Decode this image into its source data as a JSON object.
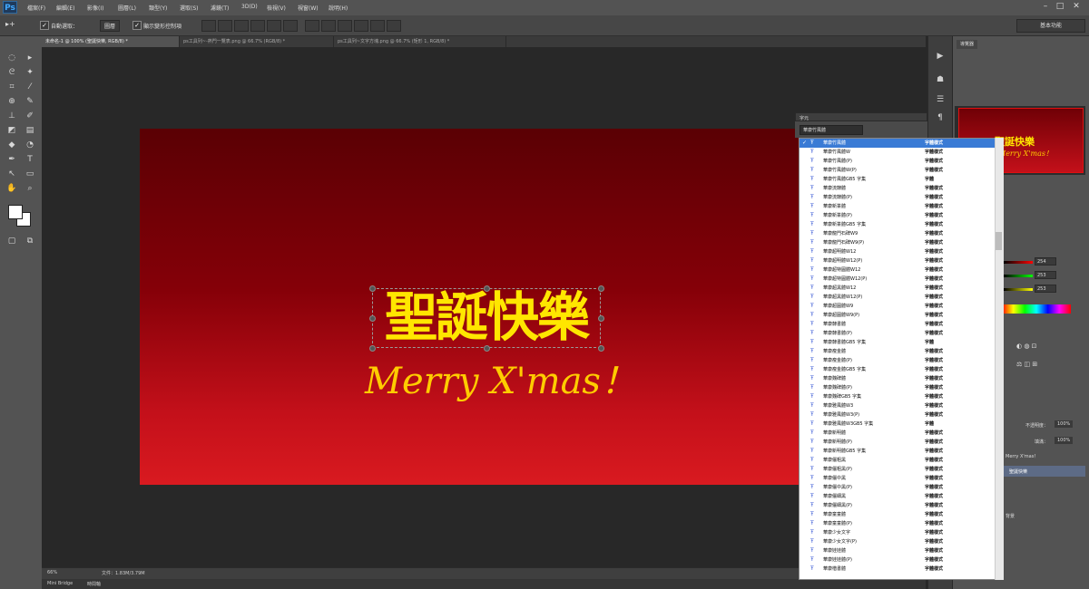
{
  "app": {
    "logo": "Ps"
  },
  "menu": [
    "檔案(F)",
    "編輯(E)",
    "影像(I)",
    "圖層(L)",
    "類型(Y)",
    "選取(S)",
    "濾鏡(T)",
    "3D(D)",
    "檢視(V)",
    "視窗(W)",
    "說明(H)"
  ],
  "window_controls": {
    "min": "–",
    "max": "□",
    "close": "✕"
  },
  "options_bar": {
    "auto_select_label": "自動選取：",
    "auto_select_value": "圖層",
    "show_transform_label": "顯示變形控制項",
    "workspace": "基本功能"
  },
  "tabs": [
    "未命名-1 @ 100% (聖誕快樂, RGB/8) *",
    "ps工具列~-熱門一覽表.png @ 66.7% (RGB/8) *",
    "ps工具列~文字方塊.png @ 66.7% (矩形 1, RGB/8) *"
  ],
  "document": {
    "title_cn": "聖誕快樂",
    "title_en": "Merry X'mas！",
    "gradient_colors": [
      "#5a0004",
      "#850008",
      "#c4101a",
      "#d91a20"
    ],
    "text_color": "#ffe600"
  },
  "status": {
    "zoom": "66%",
    "doc_info": "文件：1.83M/3.79M",
    "bridge_tab": "Mini Bridge",
    "timeline_tab": "時間軸"
  },
  "right_panel": {
    "navigator_tab": "導覽器",
    "nav_title_cn": "聖誕快樂",
    "nav_title_en": "Merry X'mas！",
    "color_values": [
      "254",
      "253",
      "253"
    ],
    "opacity_label": "不透明度：",
    "opacity_value": "100%",
    "fill_label": "填滿：",
    "fill_value": "100%",
    "layer_text": "Merry X'mas！",
    "layer_selected": "聖誕快樂",
    "layer_bg": "背景"
  },
  "font_panel": {
    "title": "字元",
    "current_font": "華康竹風體",
    "fonts": [
      {
        "name": "華康竹風體",
        "sample": "字體樣式",
        "selected": true
      },
      {
        "name": "華康竹風體W",
        "sample": "字體樣式"
      },
      {
        "name": "華康竹風體(P)",
        "sample": "字體樣式"
      },
      {
        "name": "華康竹風體W(P)",
        "sample": "字體樣式"
      },
      {
        "name": "華康竹風體GB5 字集",
        "sample": "字體"
      },
      {
        "name": "華康流隸體",
        "sample": "字體樣式"
      },
      {
        "name": "華康流隸體(P)",
        "sample": "字體樣式"
      },
      {
        "name": "華康新篆體",
        "sample": "字體樣式"
      },
      {
        "name": "華康新篆體(P)",
        "sample": "字體樣式"
      },
      {
        "name": "華康新篆體GB5 字集",
        "sample": "字體樣式"
      },
      {
        "name": "華康龍門石碑W9",
        "sample": "字體樣式"
      },
      {
        "name": "華康龍門石碑W9(P)",
        "sample": "字體樣式"
      },
      {
        "name": "華康超明體W12",
        "sample": "字體樣式"
      },
      {
        "name": "華康超明體W12(P)",
        "sample": "字體樣式"
      },
      {
        "name": "華康超特圓體W12",
        "sample": "字體樣式"
      },
      {
        "name": "華康超特圓體W12(P)",
        "sample": "字體樣式"
      },
      {
        "name": "華康超黑體W12",
        "sample": "字體樣式"
      },
      {
        "name": "華康超黑體W12(P)",
        "sample": "字體樣式"
      },
      {
        "name": "華康超圓體W9",
        "sample": "字體樣式"
      },
      {
        "name": "華康超圓體W9(P)",
        "sample": "字體樣式"
      },
      {
        "name": "華康隸書體",
        "sample": "字體樣式"
      },
      {
        "name": "華康隸書體(P)",
        "sample": "字體樣式"
      },
      {
        "name": "華康隸書體GB5 字集",
        "sample": "字體"
      },
      {
        "name": "華康瘦金體",
        "sample": "字體樣式"
      },
      {
        "name": "華康瘦金體(P)",
        "sample": "字體樣式"
      },
      {
        "name": "華康瘦金體GB5 字集",
        "sample": "字體樣式"
      },
      {
        "name": "華康魏碑體",
        "sample": "字體樣式"
      },
      {
        "name": "華康魏碑體(P)",
        "sample": "字體樣式"
      },
      {
        "name": "華康魏碑GB5 字集",
        "sample": "字體樣式"
      },
      {
        "name": "華康雅風體W3",
        "sample": "字體樣式"
      },
      {
        "name": "華康雅風體W3(P)",
        "sample": "字體樣式"
      },
      {
        "name": "華康雅風體W3GB5 字集",
        "sample": "字體"
      },
      {
        "name": "華康新明體",
        "sample": "字體樣式"
      },
      {
        "name": "華康新明體(P)",
        "sample": "字體樣式"
      },
      {
        "name": "華康新明體GB5 字集",
        "sample": "字體樣式"
      },
      {
        "name": "華康儷粗黑",
        "sample": "字體樣式"
      },
      {
        "name": "華康儷粗黑(P)",
        "sample": "字體樣式"
      },
      {
        "name": "華康儷中黑",
        "sample": "字體樣式"
      },
      {
        "name": "華康儷中黑(P)",
        "sample": "字體樣式"
      },
      {
        "name": "華康儷細黑",
        "sample": "字體樣式"
      },
      {
        "name": "華康儷細黑(P)",
        "sample": "字體樣式"
      },
      {
        "name": "華康童童體",
        "sample": "字體樣式"
      },
      {
        "name": "華康童童體(P)",
        "sample": "字體樣式"
      },
      {
        "name": "華康少女文字",
        "sample": "字體樣式"
      },
      {
        "name": "華康少女文字(P)",
        "sample": "字體樣式"
      },
      {
        "name": "華康娃娃體",
        "sample": "字體樣式"
      },
      {
        "name": "華康娃娃體(P)",
        "sample": "字體樣式"
      },
      {
        "name": "華康楷書體",
        "sample": "字體樣式"
      }
    ]
  },
  "colors": {
    "highlight": "#e01b1b",
    "selection": "#3a7bd5"
  }
}
